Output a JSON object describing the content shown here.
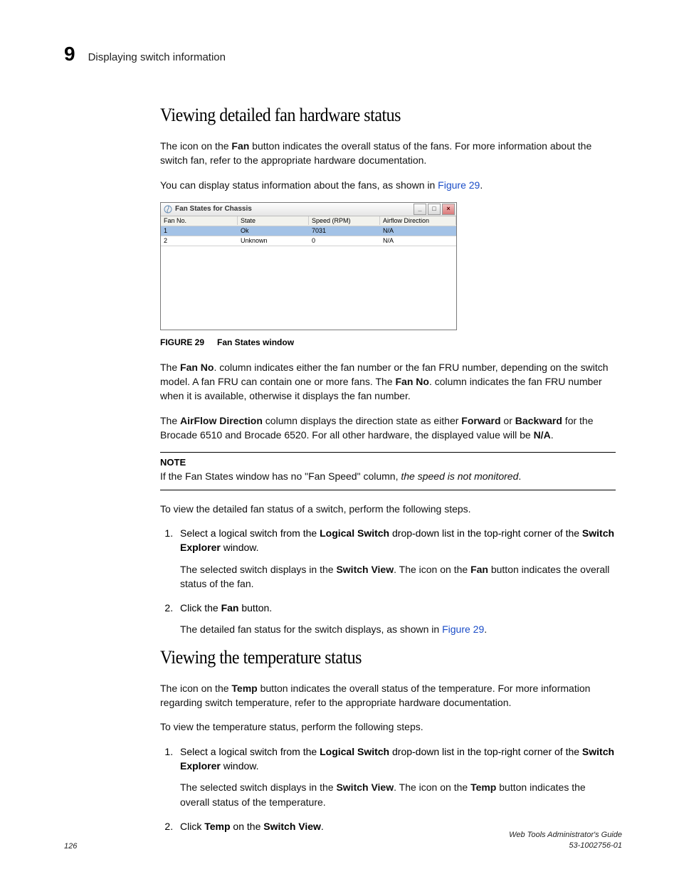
{
  "header": {
    "chapter_number": "9",
    "chapter_title": "Displaying switch information"
  },
  "section1": {
    "heading": "Viewing detailed fan hardware status",
    "p1_a": "The icon on the ",
    "p1_b": "Fan",
    "p1_c": " button indicates the overall status of the fans. For more information about the switch fan, refer to the appropriate hardware documentation.",
    "p2_a": "You can display status information about the fans, as shown in ",
    "p2_link": "Figure 29",
    "p2_b": "."
  },
  "figure": {
    "window_title": "Fan States for Chassis",
    "controls": {
      "min": "_",
      "max": "□",
      "close": "×"
    },
    "headers": {
      "no": "Fan No.",
      "state": "State",
      "speed": "Speed (RPM)",
      "air": "Airflow Direction"
    },
    "rows": [
      {
        "no": "1",
        "state": "Ok",
        "speed": "7031",
        "air": "N/A"
      },
      {
        "no": "2",
        "state": "Unknown",
        "speed": "0",
        "air": "N/A"
      }
    ],
    "caption_num": "FIGURE 29",
    "caption_title": "Fan States window"
  },
  "section1b": {
    "p3_a": "The ",
    "p3_b": "Fan No",
    "p3_c": ". column indicates either the fan number or the fan FRU number, depending on the switch model. A fan FRU can contain one or more fans. The ",
    "p3_d": "Fan No",
    "p3_e": ". column indicates the fan FRU number when it is available, otherwise it displays the fan number.",
    "p4_a": "The ",
    "p4_b": "AirFlow Direction",
    "p4_c": " column displays the direction state as either ",
    "p4_d": "Forward",
    "p4_e": " or ",
    "p4_f": "Backward",
    "p4_g": " for the Brocade 6510 and Brocade 6520. For all other hardware, the displayed value will be ",
    "p4_h": "N/A",
    "p4_i": "."
  },
  "note": {
    "label": "NOTE",
    "text_a": "If the Fan States window has no \"Fan Speed\" column, ",
    "text_b": "the speed is not monitored",
    "text_c": "."
  },
  "steps1": {
    "intro": "To view the detailed fan status of a switch, perform the following steps.",
    "s1_a": "Select a logical switch from the ",
    "s1_b": "Logical Switch",
    "s1_c": " drop-down list in the top-right corner of the ",
    "s1_d": "Switch Explorer",
    "s1_e": " window.",
    "s1_sub_a": "The selected switch displays in the ",
    "s1_sub_b": "Switch View",
    "s1_sub_c": ". The icon on the ",
    "s1_sub_d": "Fan",
    "s1_sub_e": " button indicates the overall status of the fan.",
    "s2_a": "Click the ",
    "s2_b": "Fan",
    "s2_c": " button.",
    "s2_sub_a": "The detailed fan status for the switch displays, as shown in ",
    "s2_sub_link": "Figure 29",
    "s2_sub_b": "."
  },
  "section2": {
    "heading": "Viewing the temperature status",
    "p1_a": "The icon on the ",
    "p1_b": "Temp",
    "p1_c": " button indicates the overall status of the temperature. For more information regarding switch temperature, refer to the appropriate hardware documentation.",
    "p2": "To view the temperature status, perform the following steps."
  },
  "steps2": {
    "s1_a": "Select a logical switch from the ",
    "s1_b": "Logical Switch",
    "s1_c": " drop-down list in the top-right corner of the ",
    "s1_d": "Switch Explorer",
    "s1_e": " window.",
    "s1_sub_a": "The selected switch displays in the ",
    "s1_sub_b": "Switch View",
    "s1_sub_c": ". The icon on the ",
    "s1_sub_d": "Temp",
    "s1_sub_e": " button indicates the overall status of the temperature.",
    "s2_a": "Click ",
    "s2_b": "Temp",
    "s2_c": " on the ",
    "s2_d": "Switch View",
    "s2_e": "."
  },
  "footer": {
    "page": "126",
    "doc_title": "Web Tools Administrator's Guide",
    "doc_num": "53-1002756-01"
  }
}
